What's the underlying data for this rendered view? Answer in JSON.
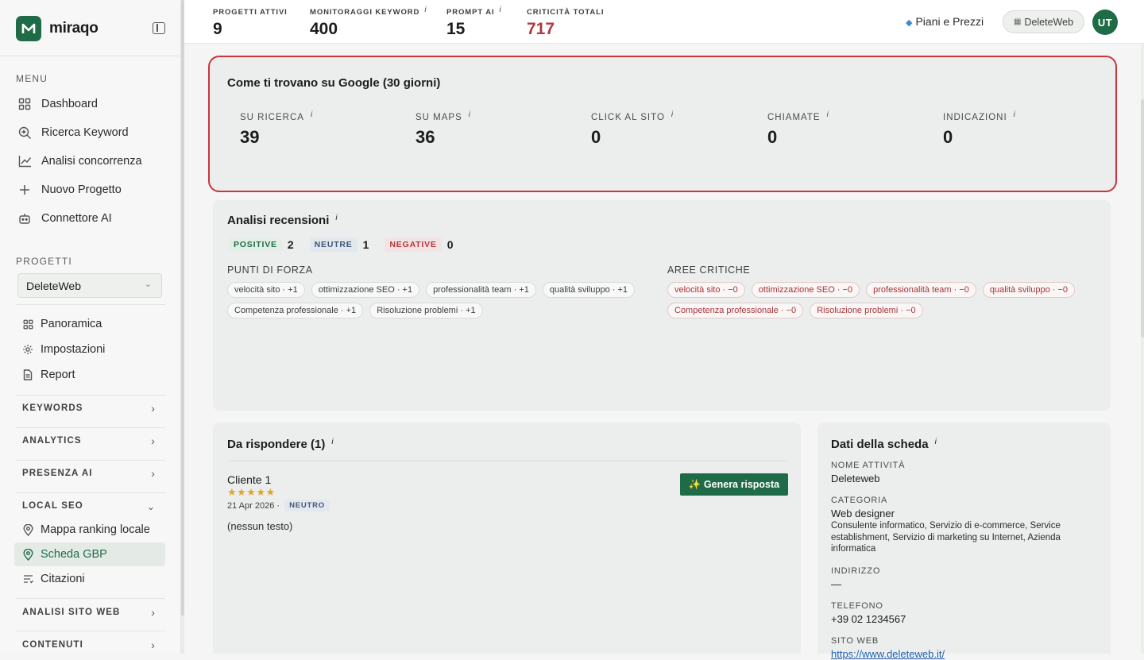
{
  "brand": {
    "name": "miraqo",
    "logo_letter": "M"
  },
  "sidebar": {
    "menu_title": "MENU",
    "menu": [
      {
        "label": "Dashboard",
        "icon": "grid-icon"
      },
      {
        "label": "Ricerca Keyword",
        "icon": "search-plus-icon"
      },
      {
        "label": "Analisi concorrenza",
        "icon": "line-chart-icon"
      },
      {
        "label": "Nuovo Progetto",
        "icon": "plus-icon"
      },
      {
        "label": "Connettore AI",
        "icon": "robot-icon"
      }
    ],
    "projects_title": "PROGETTI",
    "project_selected": "DeleteWeb",
    "project_items": [
      {
        "label": "Panoramica",
        "icon": "grid-icon"
      },
      {
        "label": "Impostazioni",
        "icon": "gear-icon"
      },
      {
        "label": "Report",
        "icon": "document-icon"
      }
    ],
    "groups": {
      "keywords": "KEYWORDS",
      "analytics": "ANALYTICS",
      "presenza_ai": "PRESENZA AI",
      "local_seo": "LOCAL SEO",
      "analisi_sito": "ANALISI SITO WEB",
      "contenuti": "CONTENUTI"
    },
    "local_seo_items": [
      {
        "label": "Mappa ranking locale",
        "icon": "pin-icon"
      },
      {
        "label": "Scheda GBP",
        "icon": "pin-icon",
        "active": true
      },
      {
        "label": "Citazioni",
        "icon": "list-icon"
      }
    ]
  },
  "topbar": {
    "stats": [
      {
        "label": "PROGETTI ATTIVI",
        "value": "9",
        "info": ""
      },
      {
        "label": "MONITORAGGI KEYWORD",
        "value": "400",
        "info": "i"
      },
      {
        "label": "PROMPT AI",
        "value": "15",
        "info": "i"
      },
      {
        "label": "CRITICITÀ TOTALI",
        "value": "717",
        "info": ""
      }
    ],
    "plans_label": "Piani e Prezzi",
    "project_pill": "DeleteWeb",
    "avatar_initials": "UT"
  },
  "google_card": {
    "title": "Come ti trovano su Google (30 giorni)",
    "stats": [
      {
        "label": "SU RICERCA",
        "value": "39"
      },
      {
        "label": "SU MAPS",
        "value": "36"
      },
      {
        "label": "CLICK AL SITO",
        "value": "0"
      },
      {
        "label": "CHIAMATE",
        "value": "0"
      },
      {
        "label": "INDICAZIONI",
        "value": "0"
      }
    ]
  },
  "reviews_card": {
    "title": "Analisi recensioni",
    "positive_label": "POSITIVE",
    "positive_count": "2",
    "neutral_label": "NEUTRE",
    "neutral_count": "1",
    "negative_label": "NEGATIVE",
    "negative_count": "0",
    "strengths_title": "PUNTI DI FORZA",
    "strengths": [
      "velocità sito · +1",
      "ottimizzazione SEO · +1",
      "professionalità team · +1",
      "qualità sviluppo · +1",
      "Competenza professionale · +1",
      "Risoluzione problemi · +1"
    ],
    "critical_title": "AREE CRITICHE",
    "critical": [
      "velocità sito · −0",
      "ottimizzazione SEO · −0",
      "professionalità team · −0",
      "qualità sviluppo · −0",
      "Competenza professionale · −0",
      "Risoluzione problemi · −0"
    ]
  },
  "reply_card": {
    "title": "Da rispondere (1)",
    "review": {
      "author": "Cliente 1",
      "stars": "★★★★★",
      "date": "21 Apr 2026 ·",
      "sentiment": "NEUTRO",
      "text": "(nessun testo)"
    },
    "generate_label": "✨ Genera risposta"
  },
  "profile_card": {
    "title": "Dati della scheda",
    "name_label": "NOME ATTIVITÀ",
    "name": "Deleteweb",
    "category_label": "CATEGORIA",
    "category": "Web designer",
    "category_extra": "Consulente informatico, Servizio di e-commerce, Service establishment, Servizio di marketing su Internet, Azienda informatica",
    "address_label": "INDIRIZZO",
    "address": "—",
    "phone_label": "TELEFONO",
    "phone": "+39 02 1234567",
    "site_label": "SITO WEB",
    "site": "https://www.deleteweb.it/"
  },
  "colors": {
    "accent": "#1f6b48",
    "danger": "#b3373b",
    "highlight_border": "#c9353c"
  }
}
